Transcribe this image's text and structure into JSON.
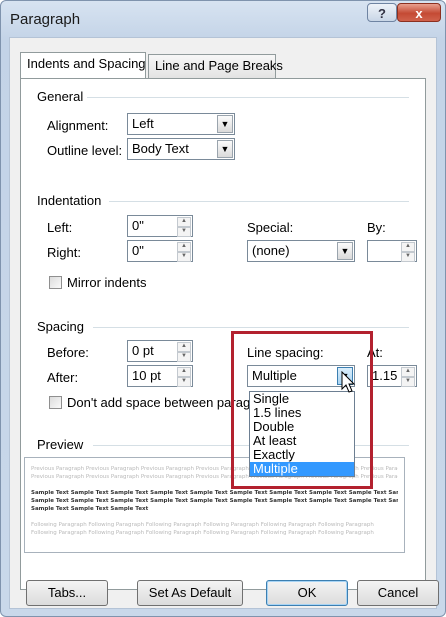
{
  "window": {
    "title": "Paragraph",
    "help_glyph": "?",
    "close_glyph": "x"
  },
  "tabs": [
    {
      "label": "Indents and Spacing",
      "active": true
    },
    {
      "label": "Line and Page Breaks",
      "active": false
    }
  ],
  "general": {
    "heading": "General",
    "alignment_label": "Alignment:",
    "alignment_value": "Left",
    "outline_label": "Outline level:",
    "outline_value": "Body Text"
  },
  "indentation": {
    "heading": "Indentation",
    "left_label": "Left:",
    "left_value": "0\"",
    "right_label": "Right:",
    "right_value": "0\"",
    "special_label": "Special:",
    "special_value": "(none)",
    "by_label": "By:",
    "by_value": "",
    "mirror_label": "Mirror indents"
  },
  "spacing": {
    "heading": "Spacing",
    "before_label": "Before:",
    "before_value": "0 pt",
    "after_label": "After:",
    "after_value": "10 pt",
    "line_spacing_label": "Line spacing:",
    "line_spacing_value": "Multiple",
    "at_label": "At:",
    "at_value": "1.15",
    "dont_add_label": "Don't add space between paragraphs of the same style",
    "line_spacing_options": [
      "Single",
      "1.5 lines",
      "Double",
      "At least",
      "Exactly",
      "Multiple"
    ],
    "selected_option": "Multiple"
  },
  "preview": {
    "heading": "Preview",
    "previous_text": "Previous Paragraph Previous Paragraph Previous Paragraph Previous Paragraph Previous Paragraph Previous Paragraph Previous Paragraph",
    "sample_text": "Sample Text Sample Text Sample Text Sample Text Sample Text Sample Text Sample Text Sample Text Sample Text Sample Text",
    "sample_text_short": "Sample Text Sample Text Sample Text",
    "following_text": "Following Paragraph Following Paragraph Following Paragraph Following Paragraph Following Paragraph Following Paragraph"
  },
  "buttons": {
    "tabs": "Tabs...",
    "set_default": "Set As Default",
    "ok": "OK",
    "cancel": "Cancel"
  },
  "icons": {
    "dropdown": "triangle-down",
    "spin": "up-down-arrows",
    "cursor": "arrow-pointer"
  },
  "colors": {
    "highlight_border": "#b3212f",
    "selection": "#3399ff",
    "close_button": "#c44a34"
  }
}
